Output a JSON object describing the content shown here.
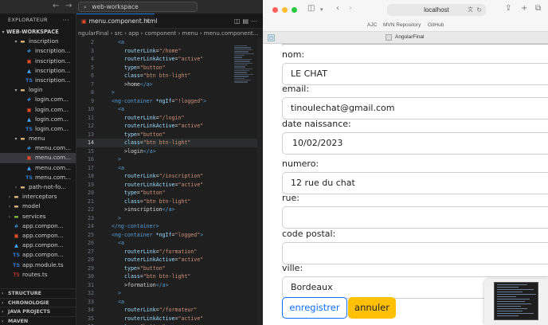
{
  "vscode": {
    "command_center": "web-workspace",
    "explorer_title": "EXPLORATEUR",
    "explorer_more": "···",
    "workspace_name": "WEB-WORKSPACE",
    "tree": [
      {
        "label": "inscription",
        "kind": "folder",
        "indent": 2,
        "open": true
      },
      {
        "label": "inscription...",
        "kind": "css",
        "indent": 3
      },
      {
        "label": "inscription...",
        "kind": "html",
        "indent": 3
      },
      {
        "label": "inscription...",
        "kind": "test",
        "indent": 3
      },
      {
        "label": "inscription...",
        "kind": "ts",
        "indent": 3
      },
      {
        "label": "login",
        "kind": "folder",
        "indent": 2,
        "open": true
      },
      {
        "label": "login.com...",
        "kind": "css",
        "indent": 3
      },
      {
        "label": "login.com...",
        "kind": "html",
        "indent": 3
      },
      {
        "label": "login.com...",
        "kind": "test",
        "indent": 3
      },
      {
        "label": "login.com...",
        "kind": "ts",
        "indent": 3
      },
      {
        "label": "menu",
        "kind": "folder",
        "indent": 2,
        "open": true
      },
      {
        "label": "menu.com...",
        "kind": "css",
        "indent": 3
      },
      {
        "label": "menu.com...",
        "kind": "html",
        "indent": 3,
        "selected": true
      },
      {
        "label": "menu.com...",
        "kind": "test",
        "indent": 3
      },
      {
        "label": "menu.com...",
        "kind": "ts",
        "indent": 3
      },
      {
        "label": "path-not-fo...",
        "kind": "folder",
        "indent": 2,
        "open": false
      },
      {
        "label": "interceptors",
        "kind": "folder",
        "indent": 1,
        "open": false
      },
      {
        "label": "model",
        "kind": "folder",
        "indent": 1,
        "open": false
      },
      {
        "label": "services",
        "kind": "folder-green",
        "indent": 1,
        "open": false
      },
      {
        "label": "app.compon...",
        "kind": "css",
        "indent": 1
      },
      {
        "label": "app.compon...",
        "kind": "html",
        "indent": 1
      },
      {
        "label": "app.compon...",
        "kind": "test",
        "indent": 1
      },
      {
        "label": "app.compon...",
        "kind": "ts",
        "indent": 1
      },
      {
        "label": "app.module.ts",
        "kind": "ts",
        "indent": 1
      },
      {
        "label": "routes.ts",
        "kind": "routes",
        "indent": 1
      }
    ],
    "panels": [
      "STRUCTURE",
      "CHRONOLOGIE",
      "JAVA PROJECTS",
      "MAVEN"
    ],
    "tab_label": "menu.component.html",
    "breadcrumb": "ngularFinal › src › app › component › menu › menu.component...",
    "active_line": "14",
    "code": [
      {
        "n": "2",
        "indent": 2,
        "parts": [
          [
            "tag",
            "<a"
          ]
        ]
      },
      {
        "n": "3",
        "indent": 3,
        "parts": [
          [
            "attr",
            "routerLink"
          ],
          [
            "txt",
            "="
          ],
          [
            "str",
            "\"/home\""
          ]
        ]
      },
      {
        "n": "4",
        "indent": 3,
        "parts": [
          [
            "attr",
            "routerLinkActive"
          ],
          [
            "txt",
            "="
          ],
          [
            "str",
            "\"active\""
          ]
        ]
      },
      {
        "n": "5",
        "indent": 3,
        "parts": [
          [
            "attr",
            "type"
          ],
          [
            "txt",
            "="
          ],
          [
            "str",
            "\"button\""
          ]
        ]
      },
      {
        "n": "6",
        "indent": 3,
        "parts": [
          [
            "attr",
            "class"
          ],
          [
            "txt",
            "="
          ],
          [
            "str",
            "\"btn btn-light\""
          ]
        ]
      },
      {
        "n": "7",
        "indent": 3,
        "parts": [
          [
            "txt",
            ">home"
          ],
          [
            "tag",
            "</a>"
          ]
        ]
      },
      {
        "n": "8",
        "indent": 1,
        "parts": [
          [
            "tag",
            ">"
          ]
        ]
      },
      {
        "n": "9",
        "indent": 1,
        "parts": [
          [
            "tag",
            "<ng-container"
          ],
          [
            "txt",
            " "
          ],
          [
            "attr",
            "*ngIf"
          ],
          [
            "txt",
            "="
          ],
          [
            "str",
            "\"!logged\""
          ],
          [
            "tag",
            ">"
          ]
        ]
      },
      {
        "n": "10",
        "indent": 2,
        "parts": [
          [
            "tag",
            "<a"
          ]
        ]
      },
      {
        "n": "11",
        "indent": 3,
        "parts": [
          [
            "attr",
            "routerLink"
          ],
          [
            "txt",
            "="
          ],
          [
            "str",
            "\"/login\""
          ]
        ]
      },
      {
        "n": "12",
        "indent": 3,
        "parts": [
          [
            "attr",
            "routerLinkActive"
          ],
          [
            "txt",
            "="
          ],
          [
            "str",
            "\"active\""
          ]
        ]
      },
      {
        "n": "13",
        "indent": 3,
        "parts": [
          [
            "attr",
            "type"
          ],
          [
            "txt",
            "="
          ],
          [
            "str",
            "\"button\""
          ]
        ]
      },
      {
        "n": "14",
        "indent": 3,
        "parts": [
          [
            "attr",
            "class"
          ],
          [
            "txt",
            "="
          ],
          [
            "str",
            "\"btn btn-light\""
          ]
        ]
      },
      {
        "n": "15",
        "indent": 3,
        "parts": [
          [
            "txt",
            ">login"
          ],
          [
            "tag",
            "</a>"
          ]
        ]
      },
      {
        "n": "16",
        "indent": 2,
        "parts": [
          [
            "tag",
            ">"
          ]
        ]
      },
      {
        "n": "17",
        "indent": 2,
        "parts": [
          [
            "tag",
            "<a"
          ]
        ]
      },
      {
        "n": "18",
        "indent": 3,
        "parts": [
          [
            "attr",
            "routerLink"
          ],
          [
            "txt",
            "="
          ],
          [
            "str",
            "\"/inscription\""
          ]
        ]
      },
      {
        "n": "19",
        "indent": 3,
        "parts": [
          [
            "attr",
            "routerLinkActive"
          ],
          [
            "txt",
            "="
          ],
          [
            "str",
            "\"active\""
          ]
        ]
      },
      {
        "n": "20",
        "indent": 3,
        "parts": [
          [
            "attr",
            "type"
          ],
          [
            "txt",
            "="
          ],
          [
            "str",
            "\"button\""
          ]
        ]
      },
      {
        "n": "21",
        "indent": 3,
        "parts": [
          [
            "attr",
            "class"
          ],
          [
            "txt",
            "="
          ],
          [
            "str",
            "\"btn btn-light\""
          ]
        ]
      },
      {
        "n": "22",
        "indent": 3,
        "parts": [
          [
            "txt",
            ">inscription"
          ],
          [
            "tag",
            "</a>"
          ]
        ]
      },
      {
        "n": "23",
        "indent": 2,
        "parts": [
          [
            "tag",
            ">"
          ]
        ]
      },
      {
        "n": "24",
        "indent": 1,
        "parts": [
          [
            "tag",
            "</ng-container>"
          ]
        ]
      },
      {
        "n": "25",
        "indent": 1,
        "parts": [
          [
            "tag",
            "<ng-container"
          ],
          [
            "txt",
            " "
          ],
          [
            "attr",
            "*ngIf"
          ],
          [
            "txt",
            "="
          ],
          [
            "str",
            "\"logged\""
          ],
          [
            "tag",
            ">"
          ]
        ]
      },
      {
        "n": "26",
        "indent": 2,
        "parts": [
          [
            "tag",
            "<a"
          ]
        ]
      },
      {
        "n": "27",
        "indent": 3,
        "parts": [
          [
            "attr",
            "routerLink"
          ],
          [
            "txt",
            "="
          ],
          [
            "str",
            "\"/formation\""
          ]
        ]
      },
      {
        "n": "28",
        "indent": 3,
        "parts": [
          [
            "attr",
            "routerLinkActive"
          ],
          [
            "txt",
            "="
          ],
          [
            "str",
            "\"active\""
          ]
        ]
      },
      {
        "n": "29",
        "indent": 3,
        "parts": [
          [
            "attr",
            "type"
          ],
          [
            "txt",
            "="
          ],
          [
            "str",
            "\"button\""
          ]
        ]
      },
      {
        "n": "30",
        "indent": 3,
        "parts": [
          [
            "attr",
            "class"
          ],
          [
            "txt",
            "="
          ],
          [
            "str",
            "\"btn btn-light\""
          ]
        ]
      },
      {
        "n": "31",
        "indent": 3,
        "parts": [
          [
            "txt",
            ">formation"
          ],
          [
            "tag",
            "</a>"
          ]
        ]
      },
      {
        "n": "32",
        "indent": 2,
        "parts": [
          [
            "tag",
            ">"
          ]
        ]
      },
      {
        "n": "33",
        "indent": 2,
        "parts": [
          [
            "tag",
            "<a"
          ]
        ]
      },
      {
        "n": "34",
        "indent": 3,
        "parts": [
          [
            "attr",
            "routerLink"
          ],
          [
            "txt",
            "="
          ],
          [
            "str",
            "\"/formateur\""
          ]
        ]
      },
      {
        "n": "35",
        "indent": 3,
        "parts": [
          [
            "attr",
            "routerLinkActive"
          ],
          [
            "txt",
            "="
          ],
          [
            "str",
            "\"active\""
          ]
        ]
      },
      {
        "n": "36",
        "indent": 3,
        "parts": [
          [
            "attr",
            "type"
          ],
          [
            "txt",
            "="
          ],
          [
            "str",
            "\"button\""
          ]
        ]
      },
      {
        "n": "37",
        "indent": 3,
        "parts": [
          [
            "attr",
            "class"
          ],
          [
            "txt",
            "="
          ],
          [
            "str",
            "\"btn btn-light\""
          ]
        ]
      }
    ]
  },
  "browser": {
    "url": "localhost",
    "favorites": [
      "AJC",
      "MVN Repository",
      "GitHub"
    ],
    "tab_title": "AngularFinal",
    "form": [
      {
        "label": "nom:",
        "value": "LE CHAT"
      },
      {
        "label": "email:",
        "value": "tinoulechat@gmail.com"
      },
      {
        "label": "date naissance:",
        "value": "10/02/2023"
      },
      {
        "label": "numero:",
        "value": "12 rue du chat"
      },
      {
        "label": "rue:",
        "value": ""
      },
      {
        "label": "code postal:",
        "value": ""
      },
      {
        "label": "ville:",
        "value": "Bordeaux"
      }
    ],
    "save_label": "enregistrer",
    "cancel_label": "annuler"
  },
  "colors": {
    "accent": "#0078d4",
    "primary_button": "#0d6efd",
    "warning_button": "#ffc107"
  }
}
